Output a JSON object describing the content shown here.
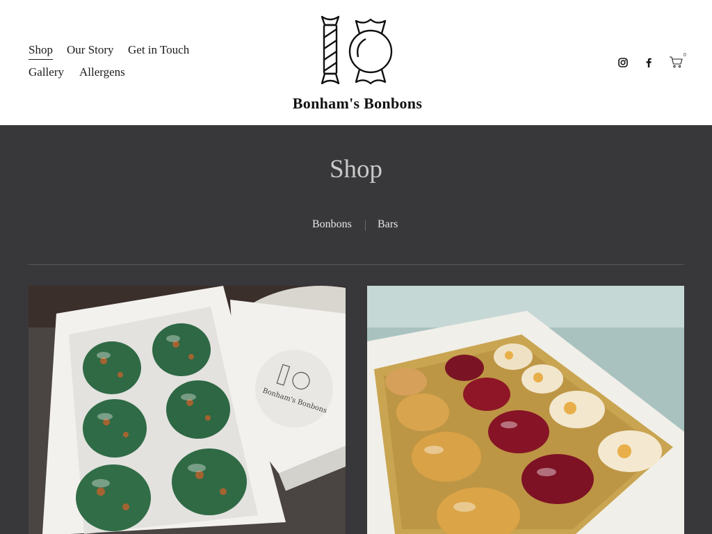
{
  "nav": {
    "items": [
      {
        "label": "Shop",
        "active": true
      },
      {
        "label": "Our Story"
      },
      {
        "label": "Get in Touch"
      },
      {
        "label": "Gallery"
      },
      {
        "label": "Allergens"
      }
    ]
  },
  "brand": {
    "name": "Bonham's Bonbons"
  },
  "social": {
    "icons": [
      "instagram-icon",
      "facebook-icon",
      "cart-icon"
    ],
    "cart_count": "0"
  },
  "page": {
    "title": "Shop"
  },
  "categories": [
    {
      "label": "Bonbons"
    },
    {
      "label": "Bars"
    }
  ],
  "products": [
    {
      "image": "box-of-six-green-bonbons",
      "label_text": "Bonham's Bonbons"
    },
    {
      "image": "box-of-sixteen-assorted-bonbons"
    }
  ],
  "colors": {
    "header_bg": "#ffffff",
    "page_bg": "#38373a",
    "title": "#c9c9c9",
    "link": "#e6e6e6"
  }
}
